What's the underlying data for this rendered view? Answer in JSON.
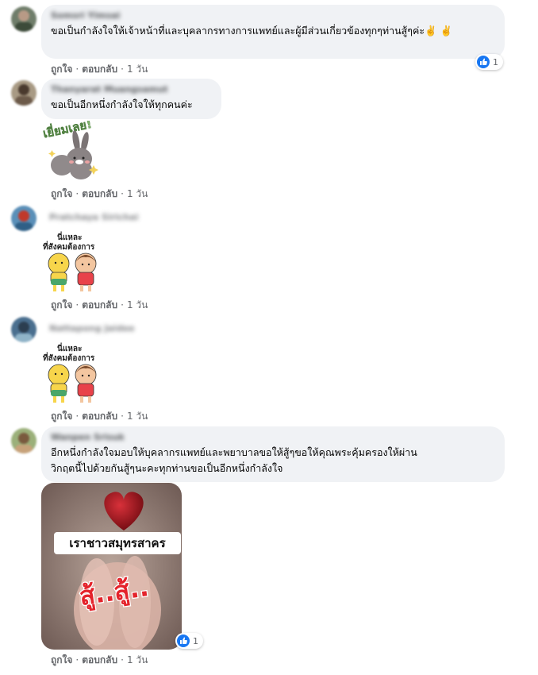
{
  "comments": [
    {
      "author": "Somsri Yimsai",
      "text": "ขอเป็นกำลังใจให้เจ้าหน้าที่และบุคลากรทางการแพทย์และผู้มีส่วนเกี่ยวข้องทุกๆท่านสู้ๆค่ะ✌️ ✌️",
      "action_like": "ถูกใจ",
      "action_reply": "ตอบกลับ",
      "age": "1 วัน",
      "reaction_count": "1"
    },
    {
      "author": "Thanyarat Muangsamut",
      "text": "ขอเป็นอีกหนึ่งกำลังใจให้ทุกคนค่ะ",
      "sticker_text": "เยี่ยมเลย!",
      "action_like": "ถูกใจ",
      "action_reply": "ตอบกลับ",
      "age": "1 วัน"
    },
    {
      "author": "Pratchaya Sirichai",
      "sticker_text_1": "นี่แหละ",
      "sticker_text_2": "ที่สังคมต้องการ",
      "action_like": "ถูกใจ",
      "action_reply": "ตอบกลับ",
      "age": "1 วัน"
    },
    {
      "author": "Nattapong Jaidee",
      "sticker_text_1": "นี่แหละ",
      "sticker_text_2": "ที่สังคมต้องการ",
      "action_like": "ถูกใจ",
      "action_reply": "ตอบกลับ",
      "age": "1 วัน"
    },
    {
      "author": "Wanpen Srisuk",
      "text_line1": "อีกหนึ่งกำลังใจมอบให้บุคลากรแพทย์และพยาบาลขอให้สู้ๆขอให้คุณพระคุ้มครองให้ผ่าน",
      "text_line2": "วิกฤตนี้ไปด้วยกันสู้ๆนะคะทุกท่านขอเป็นอีกหนึ่งกำลังใจ",
      "photo_title": "เราชาวสมุทรสาคร",
      "photo_slogan": "สู้..สู้..",
      "action_like": "ถูกใจ",
      "action_reply": "ตอบกลับ",
      "age": "1 วัน",
      "reaction_count": "1"
    }
  ],
  "colors": {
    "bubble": "#f0f2f5",
    "meta": "#65676b",
    "like_blue": "#1877f2",
    "slogan_red": "#e4232b"
  },
  "icons": [
    "thumbs-up-icon",
    "victory-hand-icon"
  ]
}
